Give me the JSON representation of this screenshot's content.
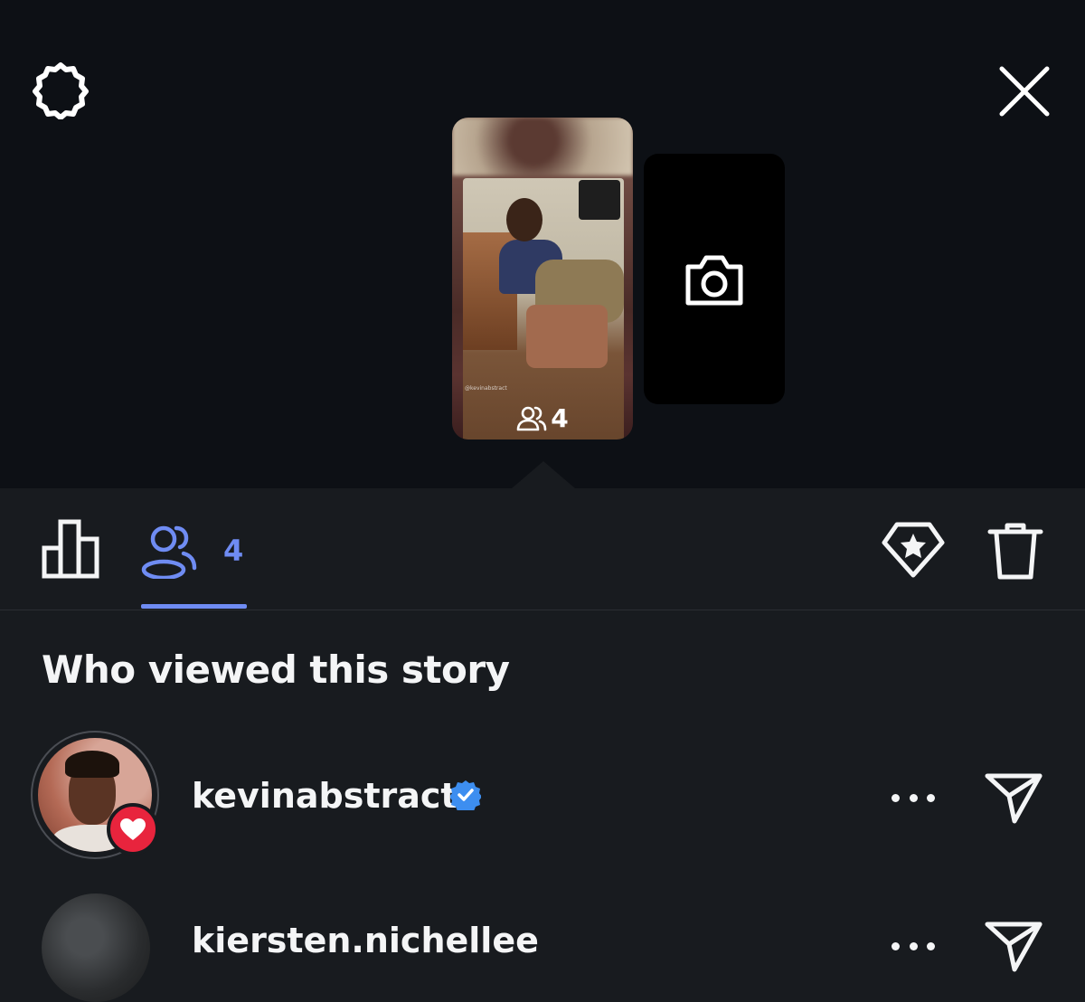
{
  "story": {
    "caption": "@kevinabstract",
    "viewer_count": "4"
  },
  "tabs": {
    "viewers_count": "4"
  },
  "section": {
    "title": "Who viewed this story"
  },
  "viewers": [
    {
      "username": "kevinabstract",
      "verified": true,
      "reaction": "heart"
    },
    {
      "username": "kiersten.nichellee",
      "verified": false
    }
  ],
  "colors": {
    "accent": "#6f8cf3",
    "background": "#181b1f",
    "top_background": "#0d1015",
    "heart": "#e8243d",
    "verified": "#3d8ef0"
  }
}
